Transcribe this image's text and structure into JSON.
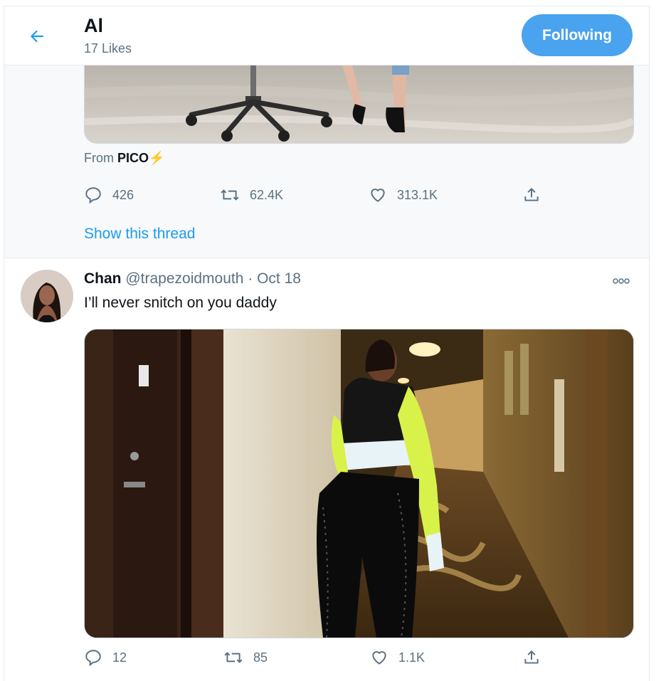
{
  "header": {
    "title": "Al",
    "subtitle": "17 Likes",
    "follow_label": "Following",
    "accent": "#4aa3ee"
  },
  "tweet1": {
    "source_prefix": "From ",
    "source_app": "PICO",
    "source_emoji": "⚡",
    "replies": "426",
    "retweets": "62.4K",
    "likes": "313.1K",
    "show_thread": "Show this thread",
    "media_icon": "office-chair-and-heels-photo"
  },
  "tweet2": {
    "name": "Chan",
    "handle": "@trapezoidmouth",
    "separator": " · ",
    "date": "Oct 18",
    "text": "I’ll never snitch on you daddy",
    "replies": "12",
    "retweets": "85",
    "likes": "1.1K",
    "media_icon": "hotel-hallway-photo"
  },
  "icons": {
    "back": "arrow-left-icon",
    "reply": "speech-bubble-icon",
    "retweet": "retweet-arrows-icon",
    "like": "heart-icon",
    "share": "share-upload-icon",
    "more": "ellipsis-icon"
  },
  "colors": {
    "link": "#1d9bf0",
    "secondary_text": "#5b7083",
    "thread_bg": "#f7f9fa"
  }
}
